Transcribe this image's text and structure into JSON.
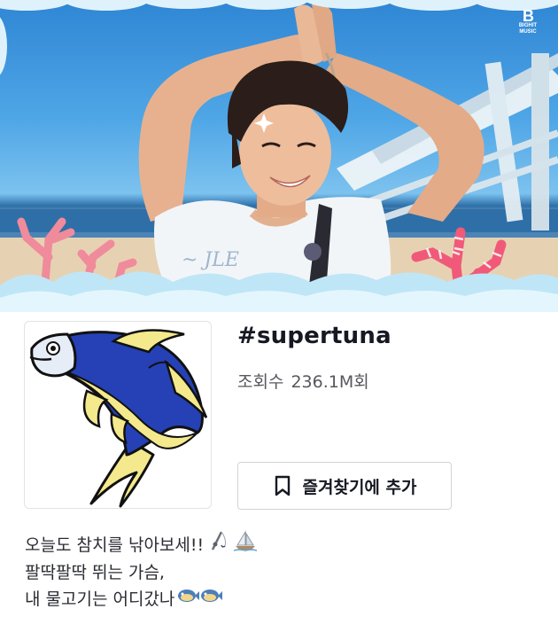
{
  "banner": {
    "brand": {
      "mark": "B",
      "word_line1": "BIGHIT",
      "word_line2": "MUSIC"
    }
  },
  "profile": {
    "avatar_icon": "tuna-fish-icon",
    "hashtag": "#supertuna",
    "views_label": "조회수",
    "views_value": "236.1M회",
    "favorite_button": {
      "icon": "bookmark-icon",
      "label": "즐겨찾기에 추가"
    },
    "description": {
      "line1": "오늘도 참치를 낚아보세!!",
      "line1_emoji": [
        "fishing-pole-icon",
        "sailboat-icon"
      ],
      "line2": "팔딱팔딱 뛰는 가슴,",
      "line3": "내 물고기는 어디갔나",
      "line3_emoji": [
        "blowfish-icon",
        "blowfish-icon"
      ]
    }
  },
  "colors": {
    "text_primary": "#161823",
    "text_secondary": "#57585e",
    "border": "#d3d3d6",
    "coral_pink": "#f06d85",
    "sky": "#4fa6e6"
  }
}
